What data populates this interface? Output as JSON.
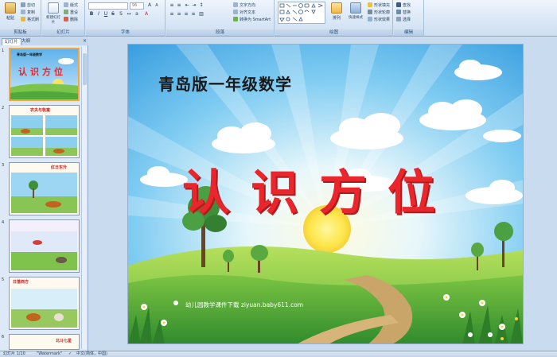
{
  "ribbon": {
    "clipboard": {
      "paste": "粘贴",
      "cut": "剪切",
      "copy": "复制",
      "format_painter": "格式刷",
      "label": "剪贴板"
    },
    "slides": {
      "new_slide": "新建幻灯片",
      "layout": "版式",
      "reset": "重设",
      "delete": "删除",
      "label": "幻灯片"
    },
    "font": {
      "font_name": "",
      "font_size": "96",
      "label": "字体"
    },
    "paragraph": {
      "text_direction": "文字方向",
      "align_text": "对齐文本",
      "convert_smartart": "转换为 SmartArt",
      "label": "段落"
    },
    "drawing": {
      "arrange": "排列",
      "quick_styles": "快速样式",
      "shape_fill": "形状填充",
      "shape_outline": "形状轮廓",
      "shape_effects": "形状效果",
      "label": "绘图"
    },
    "editing": {
      "find": "查找",
      "replace": "替换",
      "select": "选择",
      "label": "编辑"
    }
  },
  "pane": {
    "tab_slides": "幻灯片",
    "tab_outline": "大纲",
    "close": "×",
    "thumbs": [
      {
        "num": "1",
        "caption": "青岛版一年级数学",
        "big": "认识方位"
      },
      {
        "num": "2",
        "caption": "农夫与牧童"
      },
      {
        "num": "3",
        "caption": "红日东升"
      },
      {
        "num": "4",
        "caption": ""
      },
      {
        "num": "5",
        "caption": "日落西方"
      },
      {
        "num": "6",
        "caption": "北斗七星"
      }
    ]
  },
  "slide": {
    "title": "青岛版一年级数学",
    "big": "认识方位",
    "url": "幼儿园教学课件下载 ziyuan.baby611.com"
  },
  "status": {
    "slide_count": "幻灯片 1/10",
    "theme": "\"Watermark\"",
    "language": "中文(简体，中国)"
  },
  "colors": {
    "ribbon_bg": "#dbe8f6",
    "slide_title_color": "#e8262c",
    "selected_border": "#f4a640"
  }
}
